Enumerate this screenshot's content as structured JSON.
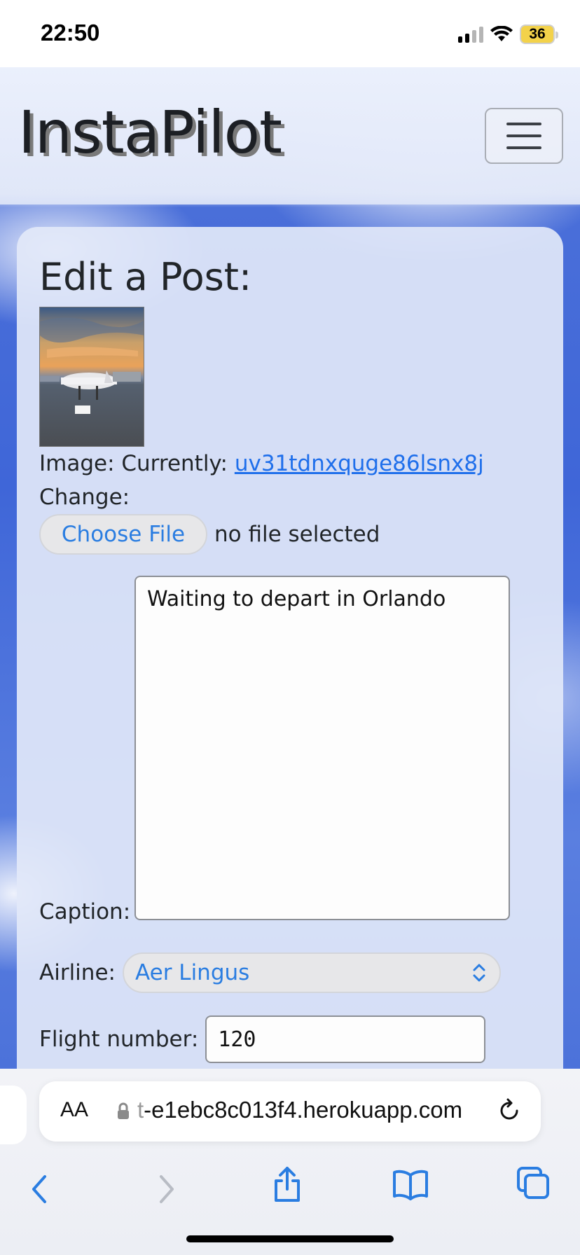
{
  "status": {
    "time": "22:50",
    "battery": "36"
  },
  "header": {
    "brand": "InstaPilot"
  },
  "form": {
    "title": "Edit a Post:",
    "image_label": "Image: Currently:",
    "image_link": "uv31tdnxquge86lsnx8j",
    "change_label": "Change:",
    "choose_file": "Choose File",
    "file_status": "no file selected",
    "caption_label": "Caption:",
    "caption_value": "Waiting to depart in Orlando",
    "airline_label": "Airline:",
    "airline_value": "Aer Lingus",
    "flight_label": "Flight number:",
    "flight_value": "120"
  },
  "browser": {
    "text_size_label": "AA",
    "url_faded": "t",
    "url_main": "-e1ebc8c013f4.herokuapp.com"
  },
  "colors": {
    "link": "#1f6feb",
    "control_accent": "#2a7de1",
    "toolbar_icon": "#2a7de1"
  }
}
